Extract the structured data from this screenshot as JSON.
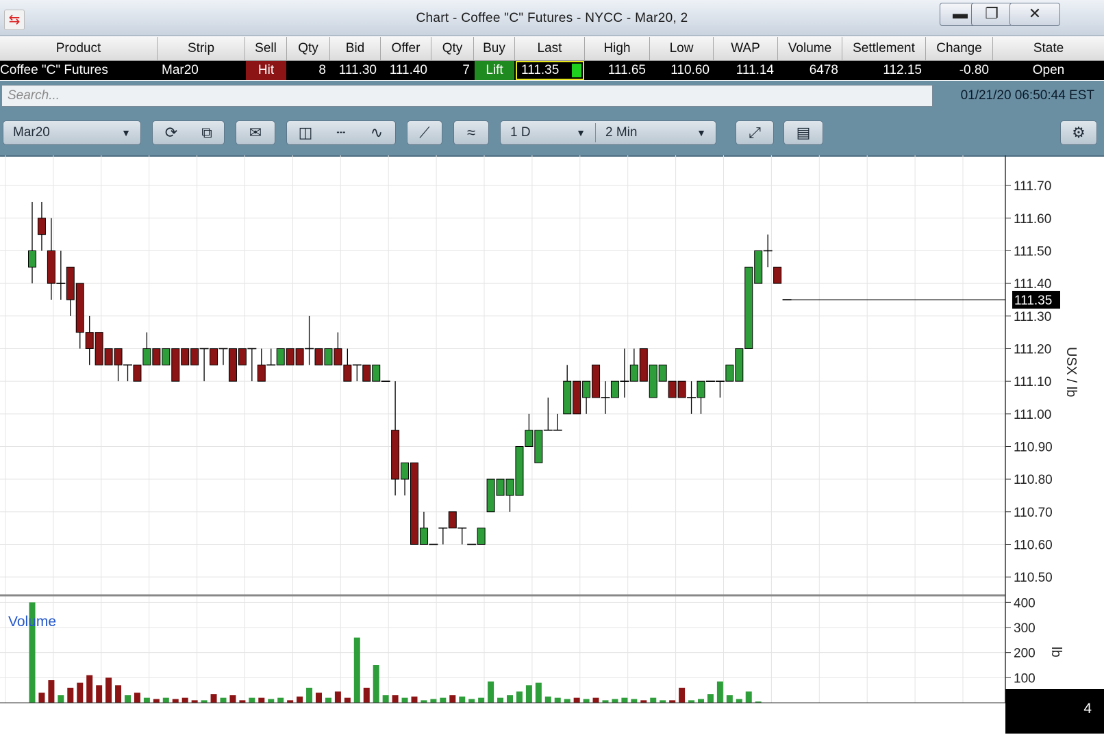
{
  "window": {
    "title": "Chart - Coffee \"C\" Futures - NYCC - Mar20, 2",
    "minimize_icon": "minimize-icon",
    "restore_icon": "restore-icon",
    "close_icon": "close-icon"
  },
  "quote_header": [
    "Product",
    "Strip",
    "Sell",
    "Qty",
    "Bid",
    "Offer",
    "Qty",
    "Buy",
    "Last",
    "High",
    "Low",
    "WAP",
    "Volume",
    "Settlement",
    "Change",
    "State"
  ],
  "quote_row": {
    "product": "Coffee \"C\" Futures",
    "strip": "Mar20",
    "sell": "Hit",
    "bid_qty": "8",
    "bid": "111.30",
    "offer": "111.40",
    "offer_qty": "7",
    "buy": "Lift",
    "last": "111.35",
    "high": "111.65",
    "low": "110.60",
    "wap": "111.14",
    "volume": "6478",
    "settlement": "112.15",
    "change": "-0.80",
    "state": "Open"
  },
  "search": {
    "placeholder": "Search...",
    "value": ""
  },
  "timestamp": "01/21/20 06:50:44 EST",
  "toolbar": {
    "contract": "Mar20",
    "period": "1 D",
    "interval": "2 Min",
    "icons": [
      "refresh-icon",
      "detach-icon",
      "envelope-icon",
      "candlestick-icon",
      "ohlc-bar-icon",
      "line-chart-icon",
      "draw-line-icon",
      "overlay-icon",
      "expand-icon",
      "indicator-icon",
      "gear-icon"
    ]
  },
  "colors": {
    "up": "#2e9e3a",
    "down": "#8c1414",
    "toolbar": "#6a8fa3",
    "hit": "#8c1414",
    "lift": "#1f8a1f"
  },
  "chart_data": [
    {
      "type": "candlestick",
      "ylabel": "USX / lb",
      "ylim": [
        110.45,
        111.78
      ],
      "yticks": [
        "111.70",
        "111.60",
        "111.50",
        "111.40",
        "111.30",
        "111.20",
        "111.10",
        "111.00",
        "110.90",
        "110.80",
        "110.70",
        "110.60",
        "110.50"
      ],
      "last_price_label": "111.35",
      "grid": true,
      "candles": [
        {
          "o": 111.45,
          "h": 111.65,
          "l": 111.4,
          "c": 111.5
        },
        {
          "o": 111.6,
          "h": 111.65,
          "l": 111.5,
          "c": 111.55
        },
        {
          "o": 111.5,
          "h": 111.6,
          "l": 111.35,
          "c": 111.4
        },
        {
          "o": 111.4,
          "h": 111.5,
          "l": 111.35,
          "c": 111.4
        },
        {
          "o": 111.45,
          "h": 111.45,
          "l": 111.3,
          "c": 111.35
        },
        {
          "o": 111.4,
          "h": 111.4,
          "l": 111.2,
          "c": 111.25
        },
        {
          "o": 111.25,
          "h": 111.3,
          "l": 111.15,
          "c": 111.2
        },
        {
          "o": 111.25,
          "h": 111.25,
          "l": 111.15,
          "c": 111.15
        },
        {
          "o": 111.2,
          "h": 111.2,
          "l": 111.15,
          "c": 111.15
        },
        {
          "o": 111.2,
          "h": 111.2,
          "l": 111.1,
          "c": 111.15
        },
        {
          "o": 111.15,
          "h": 111.15,
          "l": 111.1,
          "c": 111.15
        },
        {
          "o": 111.15,
          "h": 111.15,
          "l": 111.1,
          "c": 111.1
        },
        {
          "o": 111.15,
          "h": 111.25,
          "l": 111.15,
          "c": 111.2
        },
        {
          "o": 111.2,
          "h": 111.2,
          "l": 111.15,
          "c": 111.15
        },
        {
          "o": 111.15,
          "h": 111.2,
          "l": 111.15,
          "c": 111.2
        },
        {
          "o": 111.2,
          "h": 111.2,
          "l": 111.1,
          "c": 111.1
        },
        {
          "o": 111.2,
          "h": 111.2,
          "l": 111.15,
          "c": 111.15
        },
        {
          "o": 111.2,
          "h": 111.2,
          "l": 111.15,
          "c": 111.15
        },
        {
          "o": 111.2,
          "h": 111.2,
          "l": 111.1,
          "c": 111.2
        },
        {
          "o": 111.2,
          "h": 111.2,
          "l": 111.15,
          "c": 111.15
        },
        {
          "o": 111.2,
          "h": 111.2,
          "l": 111.15,
          "c": 111.2
        },
        {
          "o": 111.2,
          "h": 111.2,
          "l": 111.1,
          "c": 111.1
        },
        {
          "o": 111.2,
          "h": 111.2,
          "l": 111.15,
          "c": 111.15
        },
        {
          "o": 111.2,
          "h": 111.2,
          "l": 111.1,
          "c": 111.2
        },
        {
          "o": 111.15,
          "h": 111.2,
          "l": 111.1,
          "c": 111.1
        },
        {
          "o": 111.15,
          "h": 111.2,
          "l": 111.15,
          "c": 111.15
        },
        {
          "o": 111.15,
          "h": 111.2,
          "l": 111.15,
          "c": 111.2
        },
        {
          "o": 111.2,
          "h": 111.2,
          "l": 111.15,
          "c": 111.15
        },
        {
          "o": 111.2,
          "h": 111.2,
          "l": 111.15,
          "c": 111.15
        },
        {
          "o": 111.2,
          "h": 111.3,
          "l": 111.15,
          "c": 111.2
        },
        {
          "o": 111.2,
          "h": 111.2,
          "l": 111.15,
          "c": 111.15
        },
        {
          "o": 111.15,
          "h": 111.2,
          "l": 111.15,
          "c": 111.2
        },
        {
          "o": 111.2,
          "h": 111.25,
          "l": 111.15,
          "c": 111.15
        },
        {
          "o": 111.15,
          "h": 111.2,
          "l": 111.1,
          "c": 111.1
        },
        {
          "o": 111.15,
          "h": 111.15,
          "l": 111.1,
          "c": 111.15
        },
        {
          "o": 111.15,
          "h": 111.15,
          "l": 111.1,
          "c": 111.1
        },
        {
          "o": 111.1,
          "h": 111.15,
          "l": 111.1,
          "c": 111.15
        },
        {
          "o": 111.1,
          "h": 111.1,
          "l": 111.1,
          "c": 111.1
        },
        {
          "o": 110.95,
          "h": 111.1,
          "l": 110.75,
          "c": 110.8
        },
        {
          "o": 110.8,
          "h": 110.85,
          "l": 110.75,
          "c": 110.85
        },
        {
          "o": 110.85,
          "h": 110.85,
          "l": 110.6,
          "c": 110.6
        },
        {
          "o": 110.6,
          "h": 110.7,
          "l": 110.6,
          "c": 110.65
        },
        {
          "o": 110.6,
          "h": 110.6,
          "l": 110.6,
          "c": 110.6
        },
        {
          "o": 110.65,
          "h": 110.65,
          "l": 110.6,
          "c": 110.65
        },
        {
          "o": 110.7,
          "h": 110.7,
          "l": 110.65,
          "c": 110.65
        },
        {
          "o": 110.65,
          "h": 110.65,
          "l": 110.6,
          "c": 110.65
        },
        {
          "o": 110.6,
          "h": 110.6,
          "l": 110.6,
          "c": 110.6
        },
        {
          "o": 110.6,
          "h": 110.65,
          "l": 110.6,
          "c": 110.65
        },
        {
          "o": 110.7,
          "h": 110.8,
          "l": 110.7,
          "c": 110.8
        },
        {
          "o": 110.75,
          "h": 110.8,
          "l": 110.75,
          "c": 110.8
        },
        {
          "o": 110.75,
          "h": 110.8,
          "l": 110.7,
          "c": 110.8
        },
        {
          "o": 110.75,
          "h": 110.9,
          "l": 110.75,
          "c": 110.9
        },
        {
          "o": 110.9,
          "h": 111.0,
          "l": 110.9,
          "c": 110.95
        },
        {
          "o": 110.85,
          "h": 110.95,
          "l": 110.85,
          "c": 110.95
        },
        {
          "o": 110.95,
          "h": 111.05,
          "l": 110.95,
          "c": 110.95
        },
        {
          "o": 110.95,
          "h": 111.0,
          "l": 110.95,
          "c": 110.95
        },
        {
          "o": 111.0,
          "h": 111.15,
          "l": 111.0,
          "c": 111.1
        },
        {
          "o": 111.1,
          "h": 111.1,
          "l": 111.0,
          "c": 111.0
        },
        {
          "o": 111.05,
          "h": 111.1,
          "l": 111.0,
          "c": 111.1
        },
        {
          "o": 111.15,
          "h": 111.15,
          "l": 111.05,
          "c": 111.05
        },
        {
          "o": 111.05,
          "h": 111.1,
          "l": 111.0,
          "c": 111.05
        },
        {
          "o": 111.05,
          "h": 111.1,
          "l": 111.05,
          "c": 111.1
        },
        {
          "o": 111.1,
          "h": 111.2,
          "l": 111.05,
          "c": 111.1
        },
        {
          "o": 111.1,
          "h": 111.2,
          "l": 111.1,
          "c": 111.15
        },
        {
          "o": 111.2,
          "h": 111.2,
          "l": 111.1,
          "c": 111.1
        },
        {
          "o": 111.05,
          "h": 111.15,
          "l": 111.05,
          "c": 111.15
        },
        {
          "o": 111.1,
          "h": 111.15,
          "l": 111.1,
          "c": 111.15
        },
        {
          "o": 111.1,
          "h": 111.1,
          "l": 111.05,
          "c": 111.05
        },
        {
          "o": 111.1,
          "h": 111.1,
          "l": 111.05,
          "c": 111.05
        },
        {
          "o": 111.05,
          "h": 111.1,
          "l": 111.0,
          "c": 111.05
        },
        {
          "o": 111.05,
          "h": 111.1,
          "l": 111.0,
          "c": 111.1
        },
        {
          "o": 111.1,
          "h": 111.1,
          "l": 111.1,
          "c": 111.1
        },
        {
          "o": 111.1,
          "h": 111.1,
          "l": 111.05,
          "c": 111.1
        },
        {
          "o": 111.1,
          "h": 111.15,
          "l": 111.1,
          "c": 111.15
        },
        {
          "o": 111.1,
          "h": 111.2,
          "l": 111.1,
          "c": 111.2
        },
        {
          "o": 111.2,
          "h": 111.45,
          "l": 111.2,
          "c": 111.45
        },
        {
          "o": 111.4,
          "h": 111.5,
          "l": 111.4,
          "c": 111.5
        },
        {
          "o": 111.5,
          "h": 111.55,
          "l": 111.45,
          "c": 111.5
        },
        {
          "o": 111.45,
          "h": 111.45,
          "l": 111.4,
          "c": 111.4
        },
        {
          "o": 111.35,
          "h": 111.35,
          "l": 111.35,
          "c": 111.35
        }
      ]
    },
    {
      "type": "bar",
      "title": "Volume",
      "ylabel": "lb",
      "ylim": [
        0,
        420
      ],
      "yticks": [
        "400",
        "300",
        "200",
        "100"
      ],
      "corner_value": "4",
      "values": [
        400,
        40,
        90,
        30,
        60,
        80,
        110,
        70,
        100,
        70,
        30,
        40,
        20,
        15,
        20,
        15,
        20,
        10,
        10,
        35,
        20,
        30,
        10,
        20,
        20,
        15,
        20,
        10,
        25,
        60,
        40,
        20,
        45,
        20,
        260,
        60,
        150,
        30,
        30,
        20,
        25,
        10,
        15,
        20,
        30,
        25,
        15,
        20,
        85,
        20,
        30,
        45,
        70,
        80,
        25,
        20,
        15,
        20,
        15,
        20,
        10,
        15,
        20,
        15,
        10,
        20,
        10,
        10,
        60,
        10,
        15,
        35,
        85,
        30,
        15,
        45,
        5
      ],
      "series": []
    }
  ]
}
